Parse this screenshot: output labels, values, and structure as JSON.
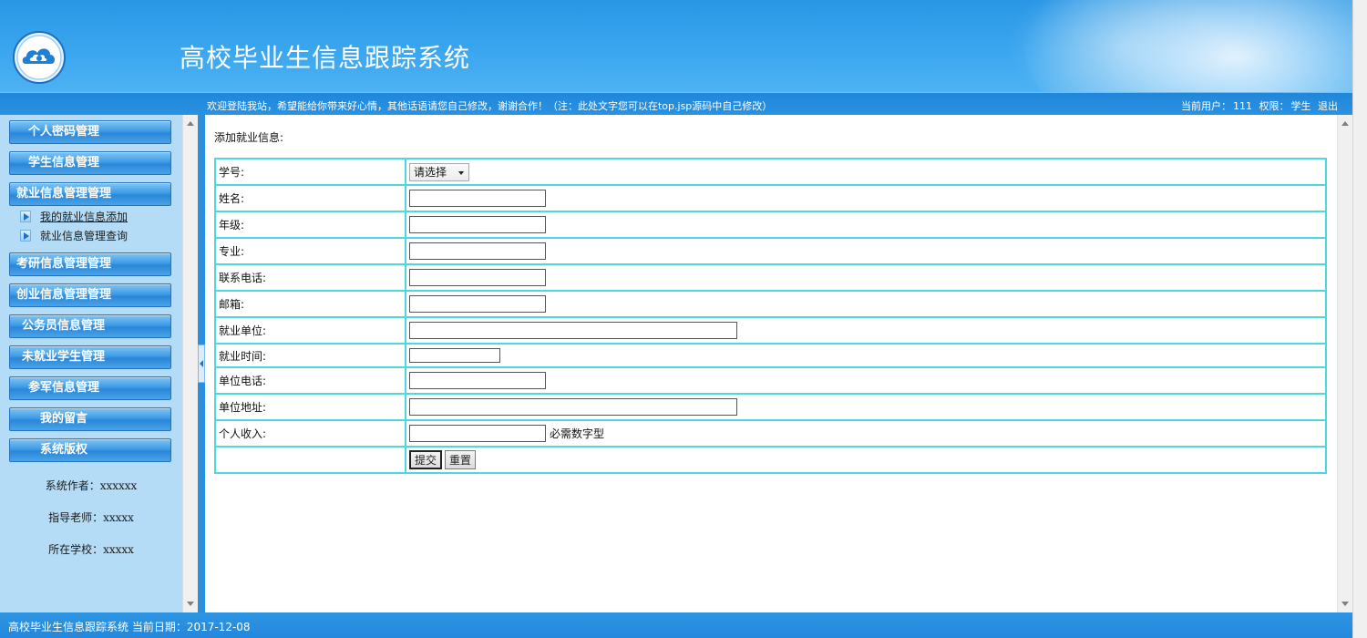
{
  "header": {
    "title": "高校毕业生信息跟踪系统",
    "logo_icon": "cloud-emblem-icon"
  },
  "info_bar": {
    "welcome": "欢迎登陆我站，希望能给你带来好心情，其他话语请您自己修改，谢谢合作！（注：此处文字您可以在top.jsp源码中自己修改）",
    "current_user_label": "当前用户：",
    "current_user": "111",
    "permission_label": "权限：",
    "permission": "学生",
    "logout": "退出"
  },
  "sidebar": {
    "menu": [
      {
        "label": "个人密码管理"
      },
      {
        "label": "学生信息管理"
      },
      {
        "label": "就业信息管理管理"
      },
      {
        "label": "考研信息管理管理"
      },
      {
        "label": "创业信息管理管理"
      },
      {
        "label": "公务员信息管理"
      },
      {
        "label": "未就业学生管理"
      },
      {
        "label": "参军信息管理"
      },
      {
        "label": "我的留言"
      },
      {
        "label": "系统版权"
      }
    ],
    "sub_items": [
      {
        "label": "我的就业信息添加"
      },
      {
        "label": "就业信息管理查询"
      }
    ],
    "credits": {
      "author": "系统作者：xxxxxx",
      "teacher": "指导老师：xxxxx",
      "school": "所在学校：xxxxx"
    }
  },
  "form": {
    "heading": "添加就业信息:",
    "labels": {
      "student_id": "学号:",
      "name": "姓名:",
      "grade": "年级:",
      "major": "专业:",
      "phone": "联系电话:",
      "email": "邮箱:",
      "employer": "就业单位:",
      "employ_time": "就业时间:",
      "employer_phone": "单位电话:",
      "employer_address": "单位地址:",
      "income": "个人收入:"
    },
    "student_id_select": "请选择",
    "values": {
      "name": "",
      "grade": "",
      "major": "",
      "phone": "",
      "email": "",
      "employer": "",
      "employ_time": "",
      "employer_phone": "",
      "employer_address": "",
      "income": ""
    },
    "income_hint": "必需数字型",
    "submit": "提交",
    "reset": "重置"
  },
  "footer": {
    "text": "高校毕业生信息跟踪系统 当前日期：2017-12-08"
  }
}
